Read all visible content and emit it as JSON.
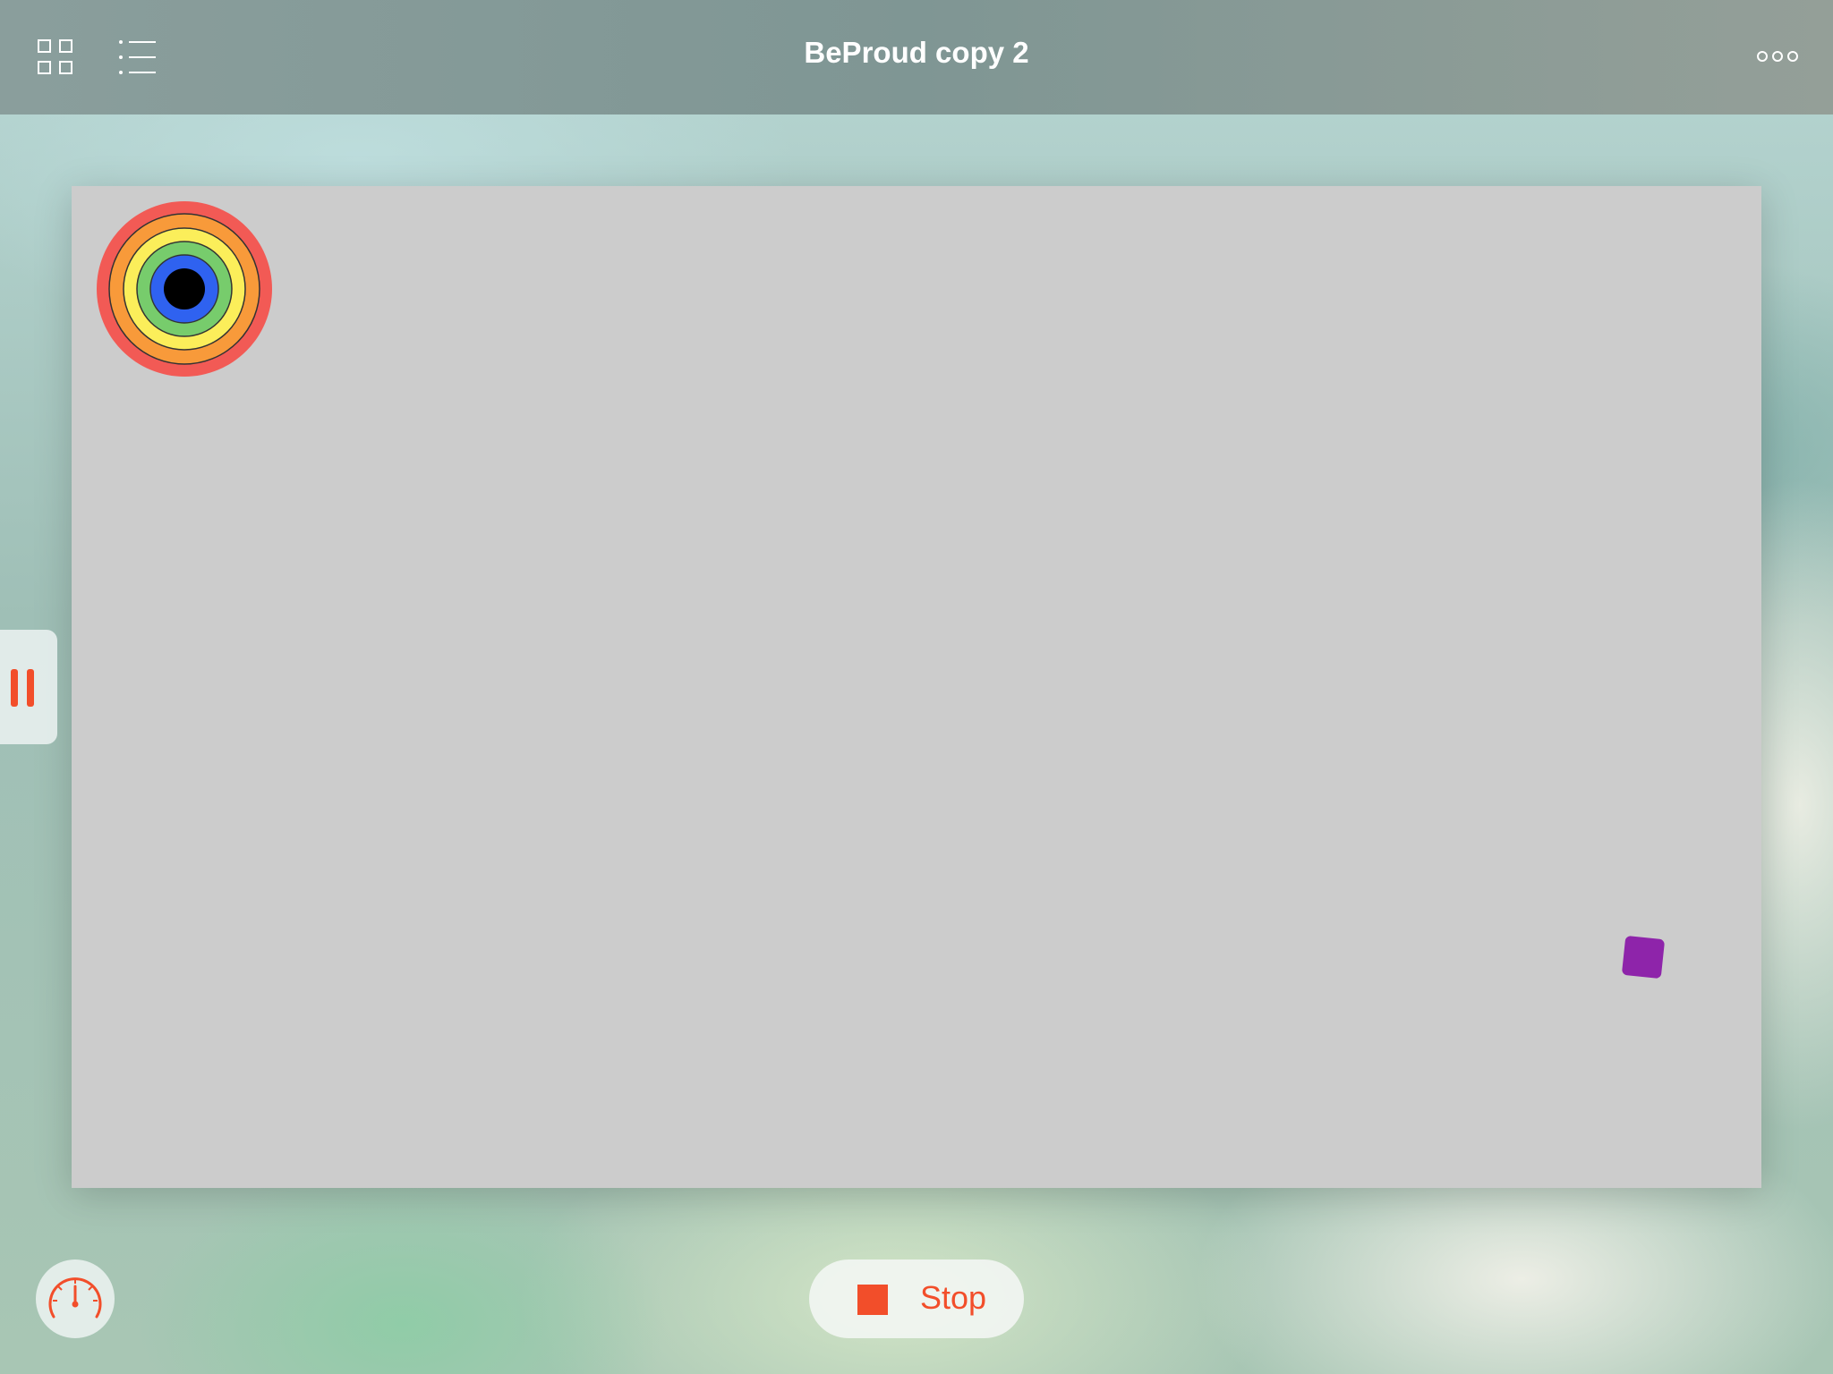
{
  "header": {
    "title": "BeProud copy 2",
    "icons": [
      "grid-icon",
      "list-icon",
      "more-icon"
    ]
  },
  "stage": {
    "rainbow_colors": [
      "#f25a55",
      "#f89a3a",
      "#fbee5a",
      "#77cc6c",
      "#2f62f0",
      "#000000"
    ],
    "square_color": "#8e24aa"
  },
  "controls": {
    "pause_icon": "pause-icon",
    "gauge_icon": "speedometer-icon",
    "stop_label": "Stop",
    "accent": "#f24e2a"
  }
}
